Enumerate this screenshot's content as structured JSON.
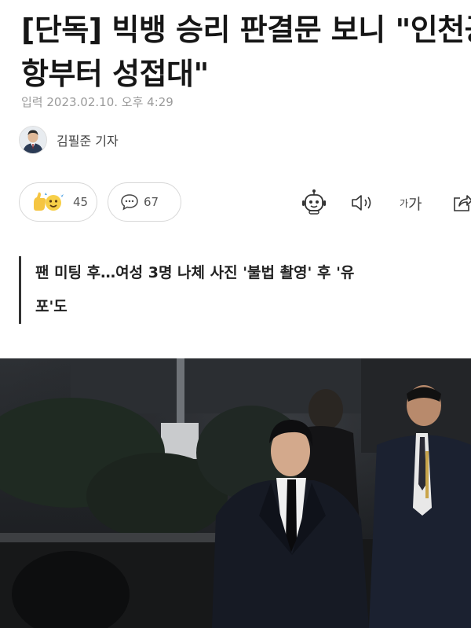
{
  "article": {
    "headline_line1": "[단독] 빅뱅 승리 판결문 보니 \"인천공",
    "headline_line2": "항부터 성접대\"",
    "dateline": "입력 2023.02.10. 오후 4:29",
    "reporter": "김필준 기자",
    "subheadline_line1": "팬 미팅 후…여성 3명 나체 사진 '불법 촬영' 후 '유",
    "subheadline_line2": "포'도"
  },
  "actions": {
    "reaction_count": "45",
    "comment_count": "67",
    "font_size_label_small": "가",
    "font_size_label_large": "가",
    "icons": [
      "emoji-reaction-icon",
      "comment-bubble-icon",
      "robot-summary-icon",
      "speaker-icon",
      "font-size-icon",
      "share-icon"
    ]
  },
  "colors": {
    "text": "#161616",
    "muted": "#9a9a9a",
    "border": "#d8d8d8",
    "accent_reaction": "#f5c542",
    "accent_reaction_blue": "#5aa9e6"
  }
}
